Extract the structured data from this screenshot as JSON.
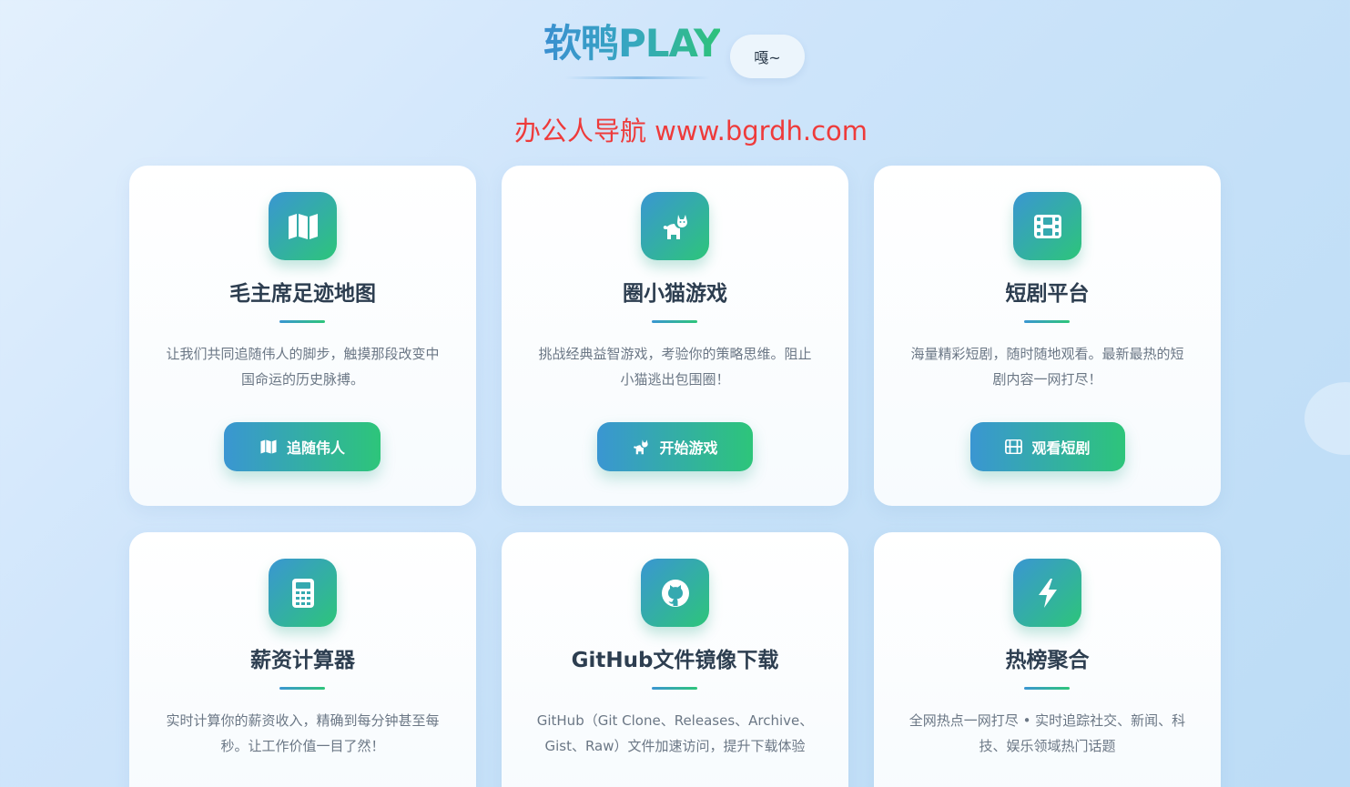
{
  "header": {
    "logo_text": "软鸭PLAY",
    "greet_button": "嘎~",
    "site_link": "办公人导航 www.bgrdh.com"
  },
  "colors": {
    "accent_start": "#3a96d2",
    "accent_end": "#2dc57a",
    "link_red": "#ee3b3b",
    "title_dark": "#2d3e50"
  },
  "cards": [
    {
      "icon": "map-icon",
      "title": "毛主席足迹地图",
      "desc": "让我们共同追随伟人的脚步，触摸那段改变中国命运的历史脉搏。",
      "button": "追随伟人"
    },
    {
      "icon": "cat-icon",
      "title": "圈小猫游戏",
      "desc": "挑战经典益智游戏，考验你的策略思维。阻止小猫逃出包围圈！",
      "button": "开始游戏"
    },
    {
      "icon": "film-icon",
      "title": "短剧平台",
      "desc": "海量精彩短剧，随时随地观看。最新最热的短剧内容一网打尽！",
      "button": "观看短剧"
    },
    {
      "icon": "calculator-icon",
      "title": "薪资计算器",
      "desc": "实时计算你的薪资收入，精确到每分钟甚至每秒。让工作价值一目了然！"
    },
    {
      "icon": "github-icon",
      "title": "GitHub文件镜像下载",
      "desc": "GitHub（Git Clone、Releases、Archive、Gist、Raw）文件加速访问，提升下载体验"
    },
    {
      "icon": "bolt-icon",
      "title": "热榜聚合",
      "desc": "全网热点一网打尽 • 实时追踪社交、新闻、科技、娱乐领域热门话题"
    }
  ]
}
